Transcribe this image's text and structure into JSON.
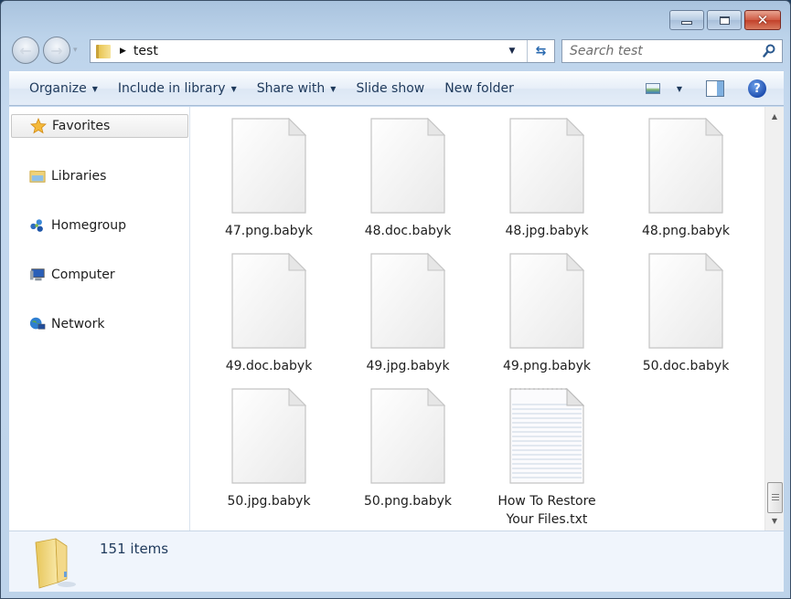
{
  "window": {
    "caption_buttons": {
      "minimize": "minimize",
      "maximize": "maximize",
      "close": "✕"
    }
  },
  "address_bar": {
    "breadcrumb_separator": "▶",
    "path": "test",
    "dropdown_glyph": "▼",
    "refresh_glyph": "⇆"
  },
  "search": {
    "placeholder": "Search test",
    "value": ""
  },
  "navigation": {
    "back_glyph": "←",
    "forward_glyph": "→",
    "recent_glyph": "▾"
  },
  "command_bar": {
    "items": [
      {
        "label": "Organize",
        "has_dropdown": true
      },
      {
        "label": "Include in library",
        "has_dropdown": true
      },
      {
        "label": "Share with",
        "has_dropdown": true
      },
      {
        "label": "Slide show",
        "has_dropdown": false
      },
      {
        "label": "New folder",
        "has_dropdown": false
      }
    ],
    "caret": "▼",
    "help_glyph": "?"
  },
  "nav_pane": {
    "items": [
      {
        "label": "Favorites",
        "icon": "star-icon",
        "selected": true
      },
      {
        "label": "Libraries",
        "icon": "libraries-icon",
        "selected": false
      },
      {
        "label": "Homegroup",
        "icon": "homegroup-icon",
        "selected": false
      },
      {
        "label": "Computer",
        "icon": "computer-icon",
        "selected": false
      },
      {
        "label": "Network",
        "icon": "network-icon",
        "selected": false
      }
    ]
  },
  "files": [
    {
      "name": "47.png.babyk",
      "type": "generic"
    },
    {
      "name": "48.doc.babyk",
      "type": "generic"
    },
    {
      "name": "48.jpg.babyk",
      "type": "generic"
    },
    {
      "name": "48.png.babyk",
      "type": "generic"
    },
    {
      "name": "49.doc.babyk",
      "type": "generic"
    },
    {
      "name": "49.jpg.babyk",
      "type": "generic"
    },
    {
      "name": "49.png.babyk",
      "type": "generic"
    },
    {
      "name": "50.doc.babyk",
      "type": "generic"
    },
    {
      "name": "50.jpg.babyk",
      "type": "generic"
    },
    {
      "name": "50.png.babyk",
      "type": "generic"
    },
    {
      "name": "How To Restore Your Files.txt",
      "type": "text"
    }
  ],
  "scrollbar": {
    "up_glyph": "▲",
    "down_glyph": "▼",
    "position_fraction": 0.97
  },
  "status_bar": {
    "item_count": "151 items"
  }
}
